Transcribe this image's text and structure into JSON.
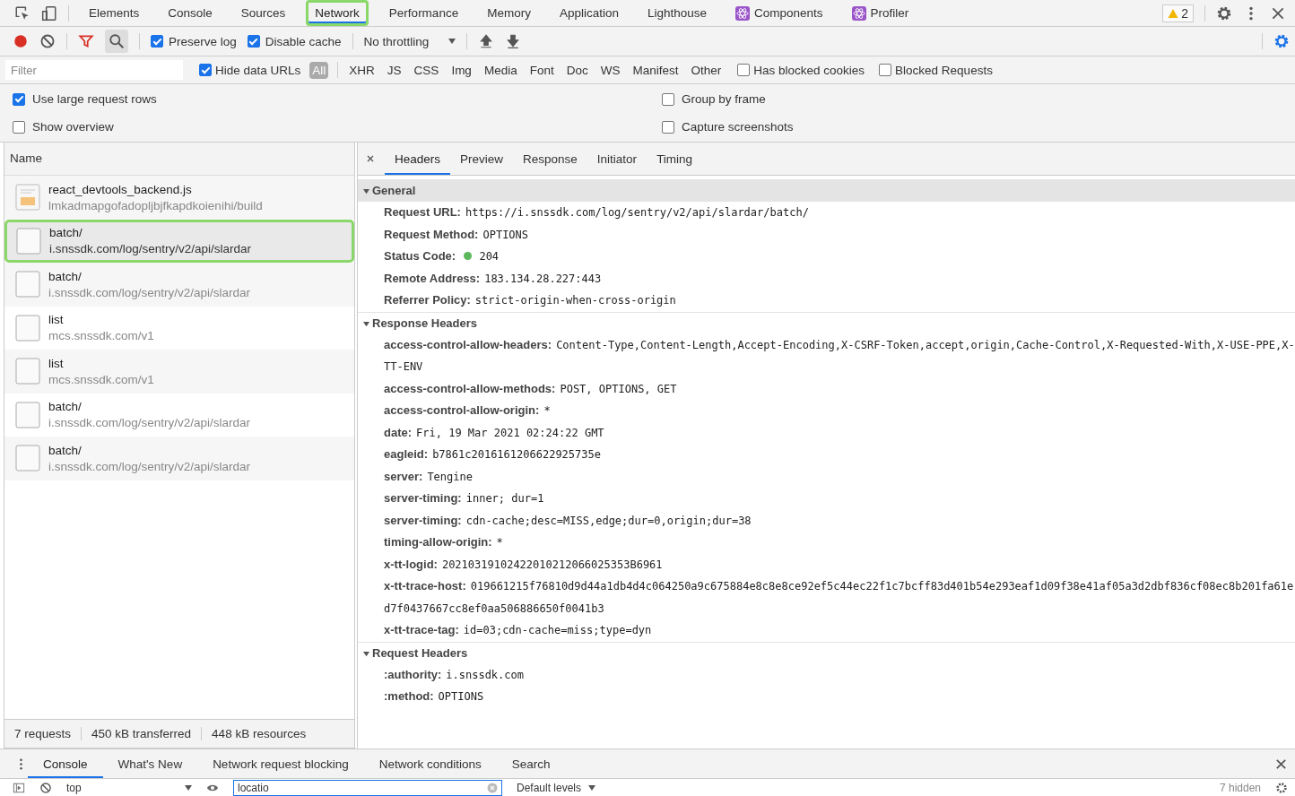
{
  "panel_tabs": [
    {
      "label": "Elements",
      "selected": false,
      "highlighted": false,
      "kind": "text"
    },
    {
      "label": "Console",
      "selected": false,
      "highlighted": false,
      "kind": "text"
    },
    {
      "label": "Sources",
      "selected": false,
      "highlighted": false,
      "kind": "text"
    },
    {
      "label": "Network",
      "selected": true,
      "highlighted": true,
      "kind": "text"
    },
    {
      "label": "Performance",
      "selected": false,
      "highlighted": false,
      "kind": "text"
    },
    {
      "label": "Memory",
      "selected": false,
      "highlighted": false,
      "kind": "text"
    },
    {
      "label": "Application",
      "selected": false,
      "highlighted": false,
      "kind": "text"
    },
    {
      "label": "Lighthouse",
      "selected": false,
      "highlighted": false,
      "kind": "text"
    },
    {
      "label": "Components",
      "selected": false,
      "highlighted": false,
      "kind": "react"
    },
    {
      "label": "Profiler",
      "selected": false,
      "highlighted": false,
      "kind": "react"
    }
  ],
  "warning_count": "2",
  "toolbar": {
    "recording": true,
    "search_active": true,
    "preserve_log": {
      "label": "Preserve log",
      "checked": true
    },
    "disable_cache": {
      "label": "Disable cache",
      "checked": true
    },
    "throttling": "No throttling"
  },
  "filter_bar": {
    "placeholder": "Filter",
    "hide_data_urls": {
      "label": "Hide data URLs",
      "checked": true
    },
    "types": [
      {
        "label": "All",
        "selected": true
      },
      {
        "label": "XHR",
        "selected": false
      },
      {
        "label": "JS",
        "selected": false
      },
      {
        "label": "CSS",
        "selected": false
      },
      {
        "label": "Img",
        "selected": false
      },
      {
        "label": "Media",
        "selected": false
      },
      {
        "label": "Font",
        "selected": false
      },
      {
        "label": "Doc",
        "selected": false
      },
      {
        "label": "WS",
        "selected": false
      },
      {
        "label": "Manifest",
        "selected": false
      },
      {
        "label": "Other",
        "selected": false
      }
    ],
    "extra": [
      {
        "label": "Has blocked cookies",
        "checked": false
      },
      {
        "label": "Blocked Requests",
        "checked": false
      }
    ]
  },
  "options": {
    "left": [
      {
        "label": "Use large request rows",
        "checked": true
      },
      {
        "label": "Show overview",
        "checked": false
      }
    ],
    "right": [
      {
        "label": "Group by frame",
        "checked": false
      },
      {
        "label": "Capture screenshots",
        "checked": false
      }
    ]
  },
  "requests": {
    "column": "Name",
    "rows": [
      {
        "name": "react_devtools_backend.js",
        "path": "lmkadmapgofadopljbjfkapdkoienihi/build",
        "kind": "script",
        "selected": false,
        "highlighted": false
      },
      {
        "name": "batch/",
        "path": "i.snssdk.com/log/sentry/v2/api/slardar",
        "kind": "other",
        "selected": true,
        "highlighted": true
      },
      {
        "name": "batch/",
        "path": "i.snssdk.com/log/sentry/v2/api/slardar",
        "kind": "other",
        "selected": false,
        "highlighted": false
      },
      {
        "name": "list",
        "path": "mcs.snssdk.com/v1",
        "kind": "other",
        "selected": false,
        "highlighted": false
      },
      {
        "name": "list",
        "path": "mcs.snssdk.com/v1",
        "kind": "other",
        "selected": false,
        "highlighted": false
      },
      {
        "name": "batch/",
        "path": "i.snssdk.com/log/sentry/v2/api/slardar",
        "kind": "other",
        "selected": false,
        "highlighted": false
      },
      {
        "name": "batch/",
        "path": "i.snssdk.com/log/sentry/v2/api/slardar",
        "kind": "other",
        "selected": false,
        "highlighted": false
      }
    ],
    "summary": [
      "7 requests",
      "450 kB transferred",
      "448 kB resources"
    ]
  },
  "detail": {
    "tabs": [
      {
        "label": "Headers",
        "selected": true
      },
      {
        "label": "Preview",
        "selected": false
      },
      {
        "label": "Response",
        "selected": false
      },
      {
        "label": "Initiator",
        "selected": false
      },
      {
        "label": "Timing",
        "selected": false
      }
    ],
    "sections": [
      {
        "title": "General",
        "expanded": true,
        "rows": [
          {
            "key": "Request URL:",
            "value": "https://i.snssdk.com/log/sentry/v2/api/slardar/batch/"
          },
          {
            "key": "Request Method:",
            "value": "OPTIONS"
          },
          {
            "key": "Status Code:",
            "value": "204",
            "color": "#5cb85c"
          },
          {
            "key": "Remote Address:",
            "value": "183.134.28.227:443"
          },
          {
            "key": "Referrer Policy:",
            "value": "strict-origin-when-cross-origin"
          }
        ]
      },
      {
        "title": "Response Headers",
        "expanded": true,
        "rows": [
          {
            "key": "access-control-allow-headers:",
            "value": "Content-Type,Content-Length,Accept-Encoding,X-CSRF-Token,accept,origin,Cache-Control,X-Requested-With,X-USE-PPE,X-TT-ENV"
          },
          {
            "key": "access-control-allow-methods:",
            "value": "POST, OPTIONS, GET"
          },
          {
            "key": "access-control-allow-origin:",
            "value": "*"
          },
          {
            "key": "date:",
            "value": "Fri, 19 Mar 2021 02:24:22 GMT"
          },
          {
            "key": "eagleid:",
            "value": "b7861c2016161206622925735e"
          },
          {
            "key": "server:",
            "value": "Tengine"
          },
          {
            "key": "server-timing:",
            "value": "inner; dur=1"
          },
          {
            "key": "server-timing:",
            "value": "cdn-cache;desc=MISS,edge;dur=0,origin;dur=38"
          },
          {
            "key": "timing-allow-origin:",
            "value": "*"
          },
          {
            "key": "x-tt-logid:",
            "value": "20210319102422010212066025353B6961"
          },
          {
            "key": "x-tt-trace-host:",
            "value": "019661215f76810d9d44a1db4d4c064250a9c675884e8c8e8ce92ef5c44ec22f1c7bcff83d401b54e293eaf1d09f38e41af05a3d2dbf836cf08ec8b201fa61ed7f0437667cc8ef0aa506886650f0041b3"
          },
          {
            "key": "x-tt-trace-tag:",
            "value": "id=03;cdn-cache=miss;type=dyn"
          }
        ]
      },
      {
        "title": "Request Headers",
        "expanded": true,
        "rows": [
          {
            "key": ":authority:",
            "value": "i.snssdk.com"
          },
          {
            "key": ":method:",
            "value": "OPTIONS"
          }
        ]
      }
    ]
  },
  "drawer": {
    "tabs": [
      {
        "label": "Console",
        "selected": true
      },
      {
        "label": "What's New",
        "selected": false
      },
      {
        "label": "Network request blocking",
        "selected": false
      },
      {
        "label": "Network conditions",
        "selected": false
      },
      {
        "label": "Search",
        "selected": false
      }
    ],
    "context": "top",
    "filter_value": "locatio",
    "levels": "Default levels",
    "hidden": "7 hidden"
  }
}
